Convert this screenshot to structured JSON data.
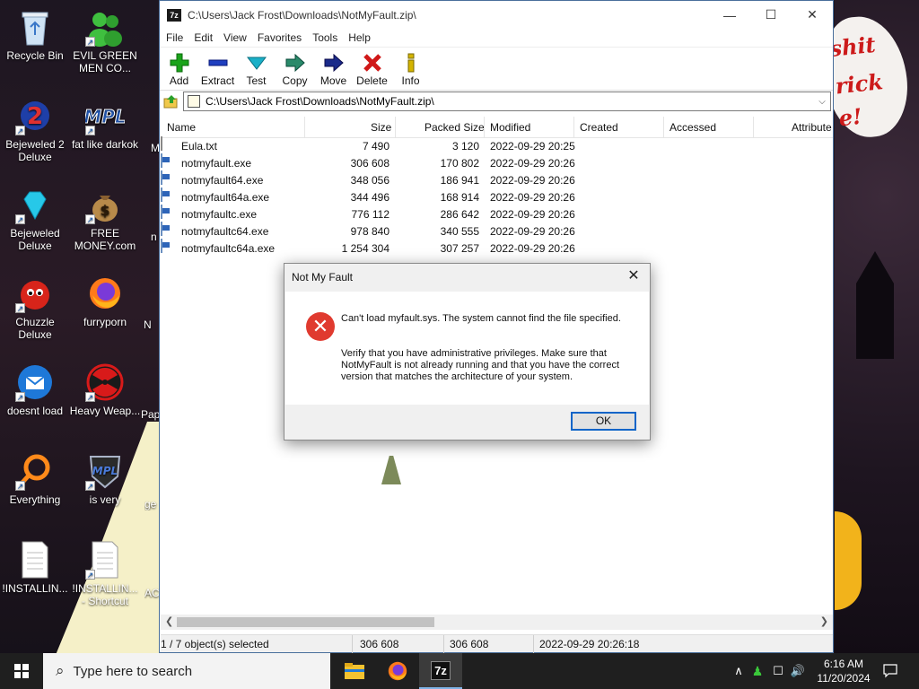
{
  "desktop": {
    "icons": [
      {
        "label": "Recycle Bin",
        "icon": "recycle-bin-icon"
      },
      {
        "label": "EVIL GREEN MEN CO...",
        "icon": "green-people-icon"
      },
      {
        "label": "Bejeweled 2 Deluxe",
        "icon": "bejeweled-2-icon"
      },
      {
        "label": "fat like darkok",
        "icon": "mpl-logo-icon"
      },
      {
        "label": "Bejeweled Deluxe",
        "icon": "diamond-icon"
      },
      {
        "label": "FREE MONEY.com",
        "icon": "money-bag-icon"
      },
      {
        "label": "Chuzzle Deluxe",
        "icon": "chuzzle-icon"
      },
      {
        "label": "furryporn",
        "icon": "firefox-icon"
      },
      {
        "label": "doesnt load",
        "icon": "thunderbird-icon"
      },
      {
        "label": "Heavy Weap...",
        "icon": "radiation-icon"
      },
      {
        "label": "Everything",
        "icon": "everything-search-icon"
      },
      {
        "label": "is very",
        "icon": "mpl-shield-icon"
      },
      {
        "label": "!INSTALLIN...",
        "icon": "document-icon"
      },
      {
        "label": "!INSTALLIN... - Shortcut",
        "icon": "document-shortcut-icon"
      }
    ],
    "partial_labels": [
      "N",
      "Pap",
      "ge",
      "AC",
      "M",
      "n"
    ],
    "wallpaper_text": [
      "shit",
      "rick",
      "e!"
    ]
  },
  "window": {
    "title": "C:\\Users\\Jack Frost\\Downloads\\NotMyFault.zip\\",
    "app_icon_text": "7z",
    "controls": {
      "minimize": "—",
      "maximize": "☐",
      "close": "✕"
    },
    "menu": [
      "File",
      "Edit",
      "View",
      "Favorites",
      "Tools",
      "Help"
    ],
    "toolbar": [
      {
        "label": "Add",
        "icon": "add-icon",
        "color": "#1aa31a"
      },
      {
        "label": "Extract",
        "icon": "extract-icon",
        "color": "#1f3fbf"
      },
      {
        "label": "Test",
        "icon": "test-icon",
        "color": "#1ab0c8"
      },
      {
        "label": "Copy",
        "icon": "copy-icon",
        "color": "#2a8a6a"
      },
      {
        "label": "Move",
        "icon": "move-icon",
        "color": "#1a2a8a"
      },
      {
        "label": "Delete",
        "icon": "delete-icon",
        "color": "#d01818"
      },
      {
        "label": "Info",
        "icon": "info-icon",
        "color": "#d4b400"
      }
    ],
    "address": "C:\\Users\\Jack Frost\\Downloads\\NotMyFault.zip\\",
    "columns": [
      "Name",
      "Size",
      "Packed Size",
      "Modified",
      "Created",
      "Accessed",
      "Attribute"
    ],
    "files": [
      {
        "name": "Eula.txt",
        "size": "7 490",
        "packed": "3 120",
        "modified": "2022-09-29 20:25",
        "type": "txt"
      },
      {
        "name": "notmyfault.exe",
        "size": "306 608",
        "packed": "170 802",
        "modified": "2022-09-29 20:26",
        "type": "exe"
      },
      {
        "name": "notmyfault64.exe",
        "size": "348 056",
        "packed": "186 941",
        "modified": "2022-09-29 20:26",
        "type": "exe"
      },
      {
        "name": "notmyfault64a.exe",
        "size": "344 496",
        "packed": "168 914",
        "modified": "2022-09-29 20:26",
        "type": "exe"
      },
      {
        "name": "notmyfaultc.exe",
        "size": "776 112",
        "packed": "286 642",
        "modified": "2022-09-29 20:26",
        "type": "exe"
      },
      {
        "name": "notmyfaultc64.exe",
        "size": "978 840",
        "packed": "340 555",
        "modified": "2022-09-29 20:26",
        "type": "exe"
      },
      {
        "name": "notmyfaultc64a.exe",
        "size": "1 254 304",
        "packed": "307 257",
        "modified": "2022-09-29 20:26",
        "type": "exe"
      }
    ],
    "status": {
      "selection": "1 / 7 object(s) selected",
      "size": "306 608",
      "packed": "306 608",
      "modified": "2022-09-29 20:26:18"
    }
  },
  "dialog": {
    "title": "Not My Fault",
    "close": "✕",
    "message_1": "Can't load myfault.sys. The system cannot find the file specified.",
    "message_2": "Verify that you have administrative privileges. Make sure that NotMyFault is not already running and that you have the correct version that matches the architecture of your system.",
    "ok_label": "OK"
  },
  "taskbar": {
    "search_placeholder": "Type here to search",
    "apps": [
      "file-explorer-icon",
      "firefox-icon",
      "7zip-icon"
    ],
    "active_app_text": "7z",
    "time": "6:16 AM",
    "date": "11/20/2024"
  }
}
